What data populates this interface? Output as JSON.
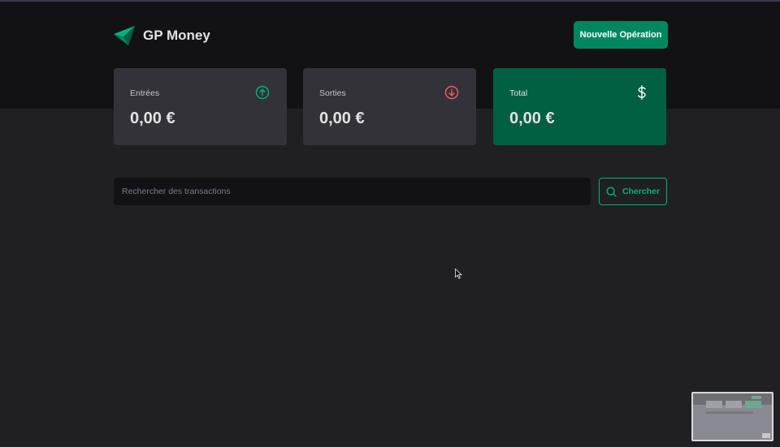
{
  "header": {
    "brand_name": "GP Money",
    "new_operation_label": "Nouvelle Opération"
  },
  "summary": {
    "income": {
      "label": "Entrées",
      "value": "0,00 €",
      "icon": "arrow-circle-up-icon",
      "color": "#00b37e"
    },
    "outcome": {
      "label": "Sorties",
      "value": "0,00 €",
      "icon": "arrow-circle-down-icon",
      "color": "#f75a68"
    },
    "total": {
      "label": "Total",
      "value": "0,00 €",
      "icon": "dollar-sign-icon",
      "color": "#015f43"
    }
  },
  "search": {
    "placeholder": "Rechercher des transactions",
    "button_label": "Chercher"
  },
  "colors": {
    "accent": "#00875f",
    "accent_light": "#00b37e",
    "background": "#202024",
    "header_background": "#121214",
    "card_background": "#323238"
  }
}
